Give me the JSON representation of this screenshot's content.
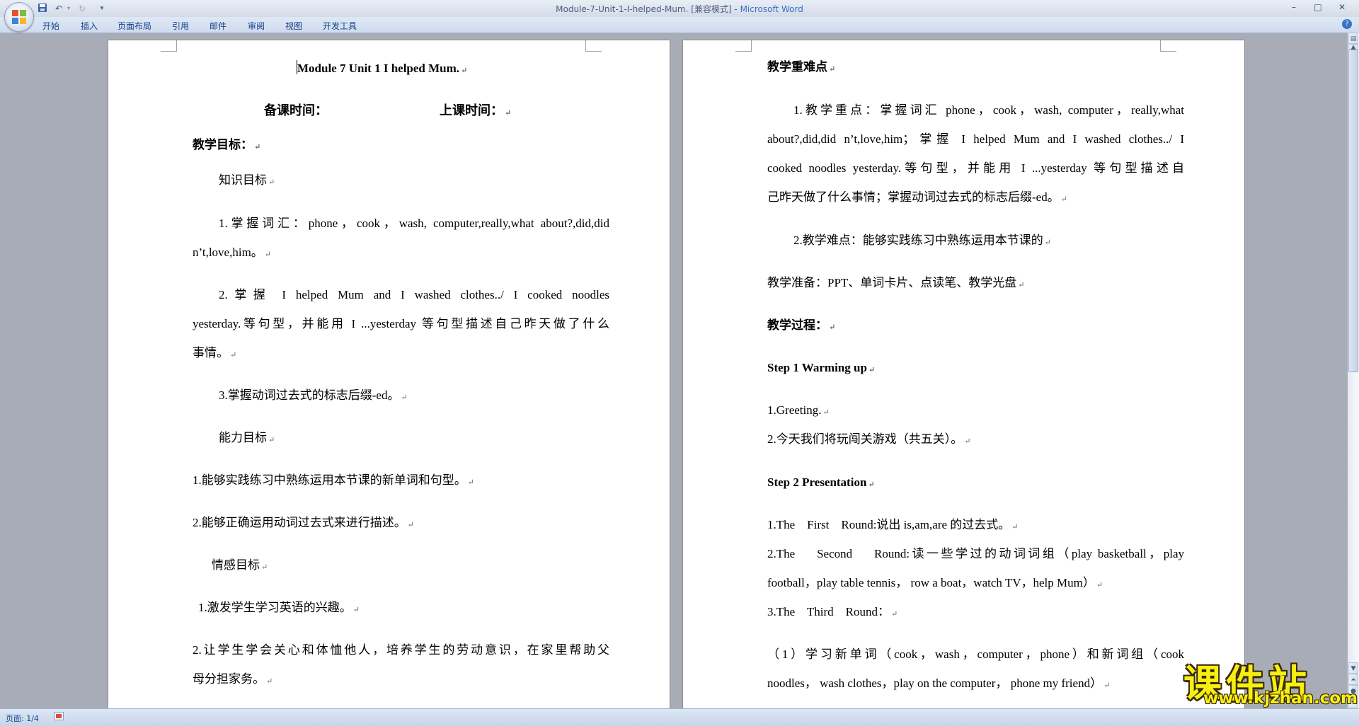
{
  "window": {
    "title": "Module-7-Unit-1-I-helped-Mum. [兼容模式] - ",
    "app": "Microsoft Word",
    "controls": {
      "minimize": "–",
      "maximize": "□",
      "close": "✕"
    }
  },
  "quick_access": {
    "save_icon": "save-icon",
    "undo_icon": "undo-icon",
    "redo_icon": "redo-icon",
    "customize_icon": "customize-icon"
  },
  "ribbon": {
    "tabs": [
      "开始",
      "插入",
      "页面布局",
      "引用",
      "邮件",
      "审阅",
      "视图",
      "开发工具"
    ],
    "help": "?"
  },
  "page1": {
    "title": "Module 7 Unit 1 I helped Mum.",
    "prep_time_label": "备课时间：",
    "class_time_label": "上课时间：",
    "objectives_heading": "教学目标：",
    "knowledge_heading": "知识目标",
    "k1_line1": "1.掌握词汇：phone，cook，wash, computer,really,what about?,did,did",
    "k1_line2": "n’t,love,him。",
    "k2_line1": "2.掌握 I helped Mum and I washed clothes../ I cooked noodles",
    "k2_line2": "yesterday.等句型，并能用 I ...yesterday  等句型描述自己昨天做了什么",
    "k2_line3": "事情。",
    "k3": "3.掌握动词过去式的标志后缀-ed。",
    "ability_heading": "能力目标",
    "a1": "1.能够实践练习中熟练运用本节课的新单词和句型。",
    "a2": "2.能够正确运用动词过去式来进行描述。",
    "emotion_heading": "情感目标",
    "e1": "1.激发学生学习英语的兴趣。",
    "e2_line1": "2.让学生学会关心和体恤他人，培养学生的劳动意识，在家里帮助父",
    "e2_line2": "母分担家务。"
  },
  "page2": {
    "key_points_heading": "教学重难点",
    "kp1_line1": "1.教学重点：掌握词汇 phone，cook，wash, computer，really,what",
    "kp1_line2": "about?,did,did n’t,love,him；掌握 I helped Mum and I washed clothes../ I",
    "kp1_line3": "cooked noodles yesterday.等句型，并能用 I ...yesterday  等句型描述自",
    "kp1_line4": "己昨天做了什么事情；掌握动词过去式的标志后缀-ed。",
    "kp2": "2.教学难点：能够实践练习中熟练运用本节课的",
    "prep": "教学准备：PPT、单词卡片、点读笔、教学光盘",
    "process_heading": "教学过程：",
    "step1": "Step 1 Warming up",
    "s1_1": "1.Greeting.",
    "s1_2": "2.今天我们将玩闯关游戏（共五关）。",
    "step2": "Step 2 Presentation",
    "r1": "1.The    First    Round:说出 is,am,are 的过去式。",
    "r2_line1": "2.The    Second    Round:读一些学过的动词词组（play basketball，play",
    "r2_line2": "football，play table tennis， row a boat，watch TV，help Mum）",
    "r3": "3.The    Third    Round：",
    "n1_line1": "（1）学习新单词（cook，wash，computer，phone）和新词组（cook",
    "n1_line2": "noodles， wash clothes，play on the computer，  phone my friend）"
  },
  "status": {
    "page_label": "页面: 1/4"
  },
  "watermark": {
    "main": "课件站",
    "url": "www.kjzhan.com"
  },
  "colors": {
    "ribbon_text": "#15428b",
    "app_name": "#3c6fc8",
    "workspace": "#a7acb6",
    "watermark": "#f6ef14"
  }
}
